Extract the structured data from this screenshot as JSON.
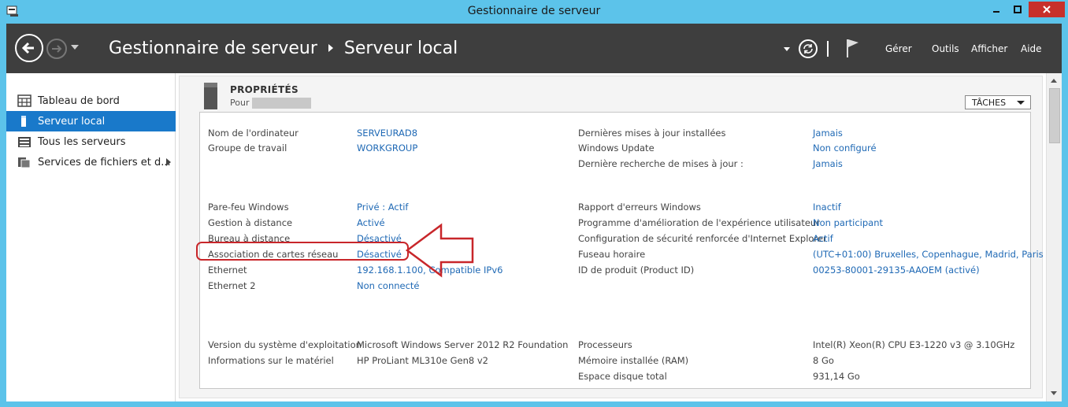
{
  "window": {
    "title": "Gestionnaire de serveur",
    "icons": {
      "app": "server-manager-icon",
      "minimize": "minimize-icon",
      "maximize": "maximize-icon",
      "close": "close-icon"
    }
  },
  "nav": {
    "breadcrumb": [
      "Gestionnaire de serveur",
      "Serveur local"
    ],
    "menu": [
      "Gérer",
      "Outils",
      "Afficher",
      "Aide"
    ],
    "icons": {
      "back": "back-arrow-icon",
      "forward": "forward-arrow-icon",
      "refresh": "refresh-icon",
      "flag": "notification-flag-icon"
    }
  },
  "sidebar": {
    "items": [
      {
        "label": "Tableau de bord",
        "icon": "dashboard-grid-icon",
        "active": false
      },
      {
        "label": "Serveur local",
        "icon": "server-icon",
        "active": true
      },
      {
        "label": "Tous les serveurs",
        "icon": "servers-list-icon",
        "active": false
      },
      {
        "label": "Services de fichiers et d...",
        "icon": "file-services-icon",
        "active": false
      }
    ]
  },
  "properties": {
    "title": "PROPRIÉTÉS",
    "for_label": "Pour",
    "tasks_label": "TÂCHES",
    "left_col": [
      {
        "label": "Nom de l'ordinateur",
        "value": "SERVEURAD8",
        "link": true
      },
      {
        "label": "Groupe de travail",
        "value": "WORKGROUP",
        "link": true
      },
      {
        "label": "Pare-feu Windows",
        "value": "Privé : Actif",
        "link": true
      },
      {
        "label": "Gestion à distance",
        "value": "Activé",
        "link": true
      },
      {
        "label": "Bureau à distance",
        "value": "Désactivé",
        "link": true
      },
      {
        "label": "Association de cartes réseau",
        "value": "Désactivé",
        "link": true
      },
      {
        "label": "Ethernet",
        "value": "192.168.1.100, Compatible IPv6",
        "link": true
      },
      {
        "label": "Ethernet 2",
        "value": "Non connecté",
        "link": true
      },
      {
        "label": "Version du système d'exploitation",
        "value": "Microsoft Windows Server 2012 R2 Foundation",
        "link": false
      },
      {
        "label": "Informations sur le matériel",
        "value": "HP ProLiant ML310e Gen8 v2",
        "link": false
      }
    ],
    "right_col": [
      {
        "label": "Dernières mises à jour installées",
        "value": "Jamais",
        "link": true
      },
      {
        "label": "Windows Update",
        "value": "Non configuré",
        "link": true
      },
      {
        "label": "Dernière recherche de mises à jour :",
        "value": "Jamais",
        "link": true
      },
      {
        "label": "Rapport d'erreurs Windows",
        "value": "Inactif",
        "link": true
      },
      {
        "label": "Programme d'amélioration de l'expérience utilisateur",
        "value": "Non participant",
        "link": true
      },
      {
        "label": "Configuration de sécurité renforcée d'Internet Explorer",
        "value": "Actif",
        "link": true
      },
      {
        "label": "Fuseau horaire",
        "value": "(UTC+01:00) Bruxelles, Copenhague, Madrid, Paris",
        "link": true
      },
      {
        "label": "ID de produit (Product ID)",
        "value": "00253-80001-29135-AAOEM (activé)",
        "link": true
      },
      {
        "label": "Processeurs",
        "value": "Intel(R) Xeon(R) CPU E3-1220 v3 @ 3.10GHz",
        "link": false
      },
      {
        "label": "Mémoire installée (RAM)",
        "value": "8 Go",
        "link": false
      },
      {
        "label": "Espace disque total",
        "value": "931,14 Go",
        "link": false
      }
    ]
  },
  "annotation": {
    "color": "#c8262a",
    "target": "Association de cartes réseau"
  }
}
